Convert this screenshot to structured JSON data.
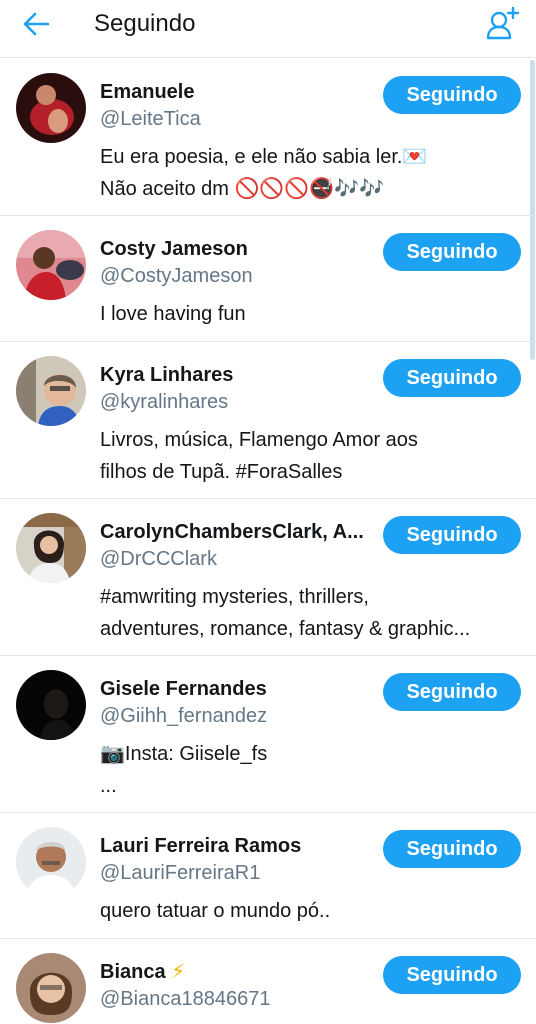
{
  "header": {
    "title": "Seguindo",
    "back_icon": "arrow-left-icon",
    "add_icon": "add-user-icon",
    "accent": "#1da1f2"
  },
  "users": [
    {
      "name": "Emanuele",
      "handle": "@LeiteTica",
      "button": "Seguindo",
      "bio": "Eu era poesia, e ele não sabia ler.💌\nNão aceito dm 🚫🚫🚫🚭🎶🎶"
    },
    {
      "name": "Costy Jameson",
      "handle": "@CostyJameson",
      "button": "Seguindo",
      "bio": "I love having fun"
    },
    {
      "name": "Kyra Linhares",
      "handle": "@kyralinhares",
      "button": "Seguindo",
      "bio": "Livros, música, Flamengo     Amor aos\nfilhos de Tupã. #ForaSalles"
    },
    {
      "name": "CarolynChambersClark, A...",
      "handle": "@DrCCClark",
      "button": "Seguindo",
      "bio": "#amwriting mysteries, thrillers,\nadventures, romance, fantasy & graphic..."
    },
    {
      "name": "Gisele Fernandes",
      "handle": "@Giihh_fernandez",
      "button": "Seguindo",
      "bio": "📷Insta: Giisele_fs\n..."
    },
    {
      "name": "Lauri Ferreira Ramos",
      "handle": "@LauriFerreiraR1",
      "button": "Seguindo",
      "bio": "quero tatuar o mundo pó.."
    },
    {
      "name": "Bianca",
      "name_badge": "⚡",
      "handle": "@Bianca18846671",
      "button": "Seguindo",
      "bio": ""
    }
  ]
}
